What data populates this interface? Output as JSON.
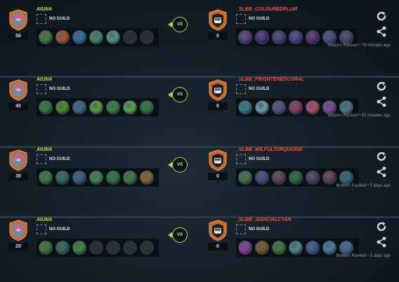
{
  "matches": [
    {
      "p1": {
        "name": "AIUNA",
        "guild": "NO GUILD",
        "score": "50",
        "legends": [
          "#3a7d3a",
          "#b0522a",
          "#2f6ea8",
          "#3d8c6a",
          "#4a9a8e",
          "empty",
          "empty"
        ]
      },
      "p2": {
        "name": "_SLBB_COLOUREDPLUM",
        "guild": "NO GUILD",
        "score": "0",
        "legends": [
          "#5a3c8c",
          "#46307a",
          "#4a3e86",
          "#503a90",
          "#5c2e7a",
          "#40508a",
          "#4a4470"
        ]
      },
      "vs": "VS",
      "meta": "Modern Ranked • 78 minutes ago"
    },
    {
      "p1": {
        "name": "AIUNA",
        "guild": "NO GUILD",
        "score": "40",
        "legends": [
          "#2f7d3a",
          "#4c8f2c",
          "#3a6a8c",
          "#5aa03c",
          "#2e8a3e",
          "#4fae4a",
          "#2a7a40"
        ]
      },
      "p2": {
        "name": "_SLBB_FRIGHTENEDCORAL",
        "guild": "NO GUILD",
        "score": "0",
        "legends": [
          "#2f7f8f",
          "#6aa0a8",
          "#5c4c8a",
          "#8a3a6a",
          "#b84a6a",
          "#7a4a9a",
          "#4a7a86"
        ]
      },
      "vs": "VS",
      "meta": "Modern Ranked • 82 minutes ago"
    },
    {
      "p1": {
        "name": "AIUNA",
        "guild": "NO GUILD",
        "score": "30",
        "legends": [
          "#3a7d3a",
          "#2a6e5e",
          "#3c5a8a",
          "#3e8a4a",
          "#2c7a3a",
          "#3a7e40",
          "#8a6a2a"
        ]
      },
      "p2": {
        "name": "_SLBB_WILFULTURQUOISE",
        "guild": "NO GUILD",
        "score": "0",
        "legends": [
          "#3a7a4a",
          "#4a4a8a",
          "#6a3a5a",
          "#2a6a3a",
          "#4a3c6a",
          "#6a3a4a",
          "#2e6a80"
        ]
      },
      "vs": "VS",
      "meta": "Modern Ranked • 5 days ago"
    },
    {
      "p1": {
        "name": "AIUNA",
        "guild": "NO GUILD",
        "score": "20",
        "legends": [
          "#3a7d3a",
          "#2e6a5a",
          "#3c8a3a",
          "empty",
          "empty",
          "empty",
          "empty"
        ]
      },
      "p2": {
        "name": "_SLBB_JUDICIALCYAN",
        "guild": "NO GUILD",
        "score": "0",
        "legends": [
          "#8a3aa0",
          "#7a5a2a",
          "#3a7a3a",
          "#4a8a8a",
          "#3a5a9a",
          "#4a7aa8",
          "#3a6a9a"
        ]
      },
      "vs": "VS",
      "meta": "Modern Ranked • 5 days ago"
    }
  ],
  "icons": {
    "refresh": "refresh-icon",
    "share": "share-icon",
    "guild": "guild-placeholder-icon"
  },
  "colors": {
    "p1_name": "#c8e03c",
    "p2_name": "#e05c52",
    "vs_accent": "#b8d83a"
  }
}
